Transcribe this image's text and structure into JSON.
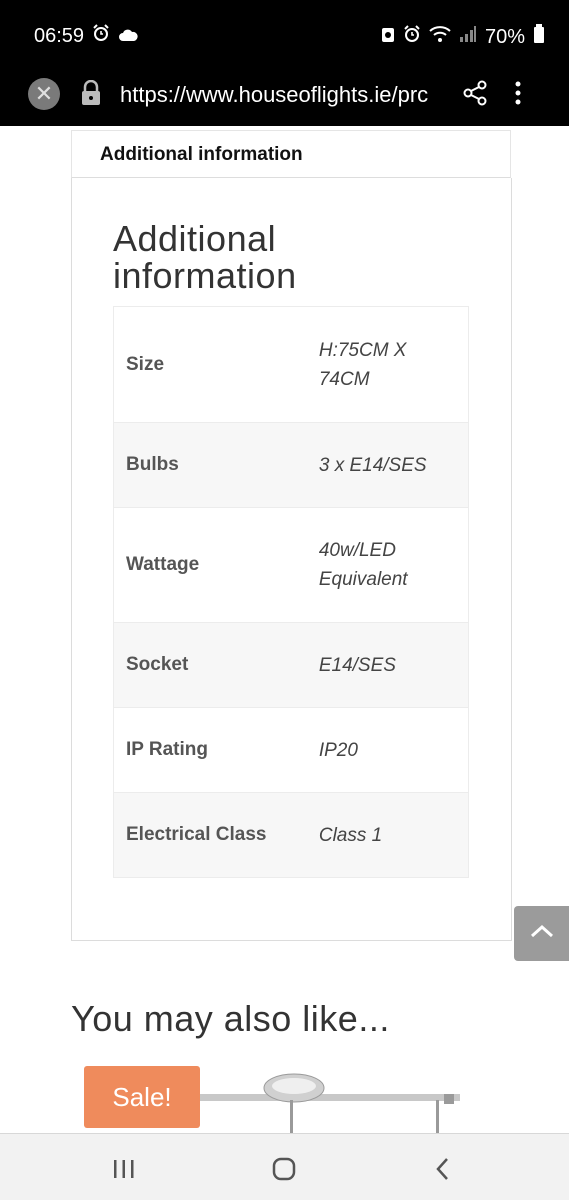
{
  "status_bar": {
    "time": "06:59",
    "battery": "70%",
    "icons": [
      "alarm-icon",
      "cloud-icon",
      "notification-icon",
      "wifi-icon",
      "signal-icon",
      "battery-icon"
    ]
  },
  "browser": {
    "url": "https://www.houseoflights.ie/prc",
    "icons": [
      "close-icon",
      "lock-icon",
      "share-icon",
      "more-vert-icon"
    ]
  },
  "tab": {
    "label": "Additional information"
  },
  "section": {
    "title": "Additional information",
    "rows": [
      {
        "label": "Size",
        "value": "H:75CM X 74CM"
      },
      {
        "label": "Bulbs",
        "value": "3 x E14/SES"
      },
      {
        "label": "Wattage",
        "value": "40w/LED Equivalent"
      },
      {
        "label": "Socket",
        "value": "E14/SES"
      },
      {
        "label": "IP Rating",
        "value": "IP20"
      },
      {
        "label": "Electrical Class",
        "value": "Class 1"
      }
    ]
  },
  "related": {
    "heading": "You may also like...",
    "sale_badge": "Sale!"
  },
  "colors": {
    "sale_badge": "#ef8b5c",
    "scroll_button": "#9b9b9b",
    "status_bar": "#000000"
  }
}
